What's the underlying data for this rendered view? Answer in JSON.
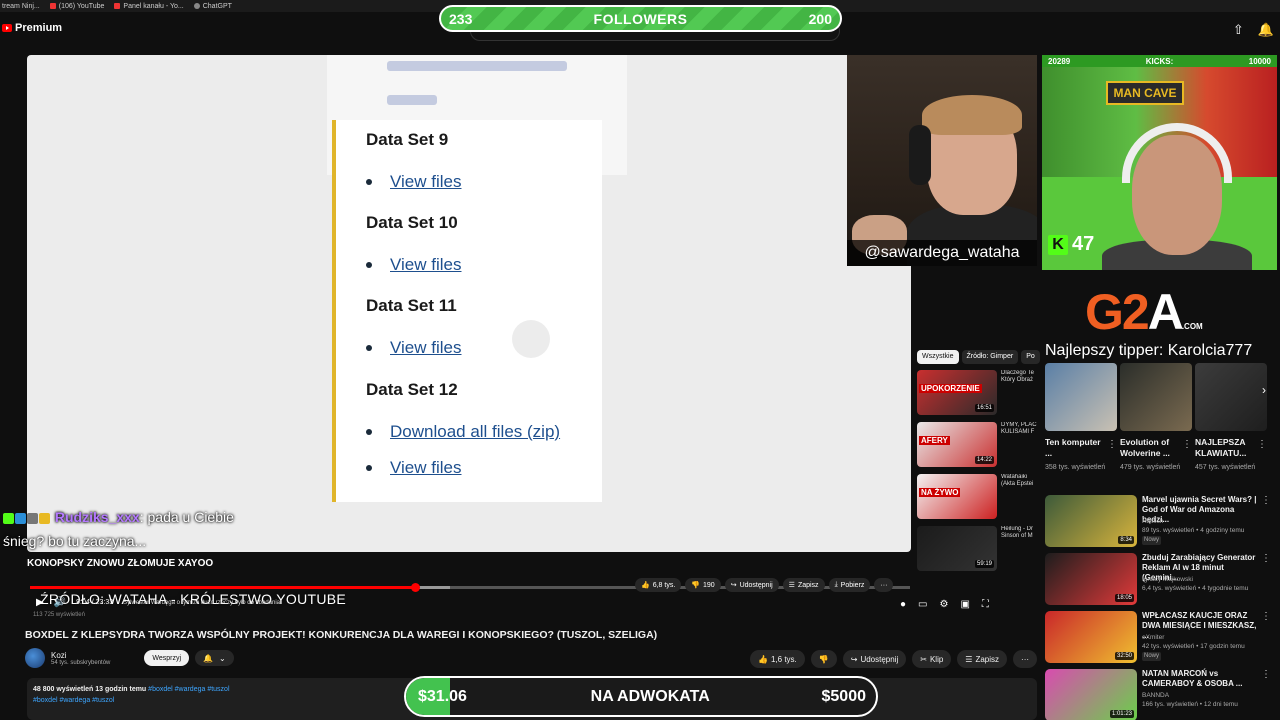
{
  "bookmarks": [
    "tream Ninj...",
    "(106) YouTube",
    "Panel kanału - Yo...",
    "ChatGPT"
  ],
  "header": {
    "logo_text": "Premium"
  },
  "followers_bar": {
    "current": "233",
    "label": "FOLLOWERS",
    "goal": "200"
  },
  "document": {
    "items": [
      {
        "kind": "heading",
        "text": "Data Set 9"
      },
      {
        "kind": "link",
        "text": "View files"
      },
      {
        "kind": "heading",
        "text": "Data Set 10"
      },
      {
        "kind": "link",
        "text": "View files"
      },
      {
        "kind": "heading",
        "text": "Data Set 11"
      },
      {
        "kind": "link",
        "text": "View files"
      },
      {
        "kind": "heading",
        "text": "Data Set 12"
      },
      {
        "kind": "link",
        "text": "Download all files (zip)"
      },
      {
        "kind": "link",
        "text": "View files"
      }
    ]
  },
  "cam1": {
    "tag": "@sawardega_wataha"
  },
  "cam2": {
    "left_count": "20289",
    "label": "KICKS:",
    "right_count": "10000",
    "sign": "MAN CAVE",
    "viewers": "47"
  },
  "g2a": {
    "g": "G2",
    "a": "A",
    "dotcom": ".COM"
  },
  "tipper": "Najlepszy tipper: Karolcia777",
  "filter_chips": [
    "Wszystkie",
    "Źródło: Gimper",
    "Po"
  ],
  "mid_items": [
    {
      "badge": "UPOKORZENIE",
      "dur": "16:51",
      "text": "Dlaczego Te Który Obraż"
    },
    {
      "badge": "AFERY",
      "dur": "14:22",
      "text": "DYMY, PLAC KULISAMI F"
    },
    {
      "badge": "NA ŻYWO",
      "dur": "",
      "text": "Watahaiki (Akta Epstei"
    },
    {
      "badge": "",
      "dur": "59:19",
      "text": "Heilung - Dr Sinson of M"
    }
  ],
  "shelf": [
    {
      "title": "Ten komputer ...",
      "meta": "358 tys. wyświetleń"
    },
    {
      "title": "Evolution of Wolverine ...",
      "meta": "479 tys. wyświetleń"
    },
    {
      "title": "NAJLEPSZA KLAWIATU...",
      "meta": "457 tys. wyświetleń"
    }
  ],
  "right_videos": [
    {
      "title": "Marvel ujawnia Secret Wars? | God of War od Amazona będzi...",
      "channel": "Hallfish",
      "meta": "89 tys. wyświetleń • 4 godziny temu",
      "badge": "Nowy",
      "dur": "8:34",
      "colors": [
        "#3d5a3a",
        "#d8b43c"
      ]
    },
    {
      "title": "Zbuduj Zarabiający Generator Reklam AI w 18 minut (Gemini...",
      "channel": "Ignacy Majkowski",
      "meta": "6,4 tys. wyświetleń • 4 tygodnie temu",
      "badge": "",
      "dur": "18:05",
      "colors": [
        "#1d1d1d",
        "#e23a3a"
      ]
    },
    {
      "title": "WPŁACASZ KAUCJE ORAZ DWA MIESIĄCE I MIESZKASZ, ...",
      "channel": "eXmiter",
      "meta": "42 tys. wyświetleń • 17 godzin temu",
      "badge": "Nowy",
      "dur": "32:50",
      "colors": [
        "#c9272a",
        "#f0c030"
      ]
    },
    {
      "title": "NATAN MARCOŃ vs CAMERABOY & OSOBA ...",
      "channel": "BANNDA",
      "meta": "166 tys. wyświetleń • 12 dni temu",
      "badge": "",
      "dur": "1:01:23",
      "colors": [
        "#d94bb0",
        "#6ad04a"
      ]
    }
  ],
  "chat": {
    "user": "Rudziks_xxx",
    "msg1": ": pada u Ciebie",
    "msg2": "śnieg? bo tu zaczyna..."
  },
  "player": {
    "overlay_title": "KONOPSKY ZNOWU ZŁOMUJE XAYOO",
    "source": "ŹRÓDŁO: WATAHA - KRÓLESTWO YOUTUBE",
    "time": "9:04 / 23:33",
    "chapter": "Sylwester Wardęga o tym że dużo rzeczy było do zbadania",
    "progress": 0.438,
    "views_small": "113 725 wyświetleń",
    "actions": [
      {
        "icon": "👍",
        "label": "6,8 tys."
      },
      {
        "icon": "👎",
        "label": "190"
      },
      {
        "icon": "↪",
        "label": "Udostępnij"
      },
      {
        "icon": "☰",
        "label": "Zapisz"
      },
      {
        "icon": "⤓",
        "label": "Pobierz"
      },
      {
        "icon": "",
        "label": "···"
      }
    ]
  },
  "video": {
    "title": "BOXDEL Z KLEPSYDRA TWORZA WSPÓLNY PROJEKT! KONKURENCJA DLA WAREGI I KONOPSKIEGO? (TUSZOL, SZELIGA)",
    "channel": "Kozi",
    "subs": "54 tys. subskrybentów",
    "support": "Wesprzyj",
    "actions": [
      {
        "icon": "👍",
        "label": "1,6 tys."
      },
      {
        "icon": "👎",
        "label": ""
      },
      {
        "icon": "↪",
        "label": "Udostępnij"
      },
      {
        "icon": "✂",
        "label": "Klip"
      },
      {
        "icon": "☰",
        "label": "Zapisz"
      },
      {
        "icon": "",
        "label": "···"
      }
    ]
  },
  "description": {
    "stats": "48 800 wyświetleń  13 godzin temu",
    "tags1": "#boxdel #wardega #tuszol",
    "tags2": "#boxdel #wardega #tuszol"
  },
  "donation": {
    "current": "$31.06",
    "label": "NA ADWOKATA",
    "goal": "$5000",
    "fraction": 0.0062
  }
}
